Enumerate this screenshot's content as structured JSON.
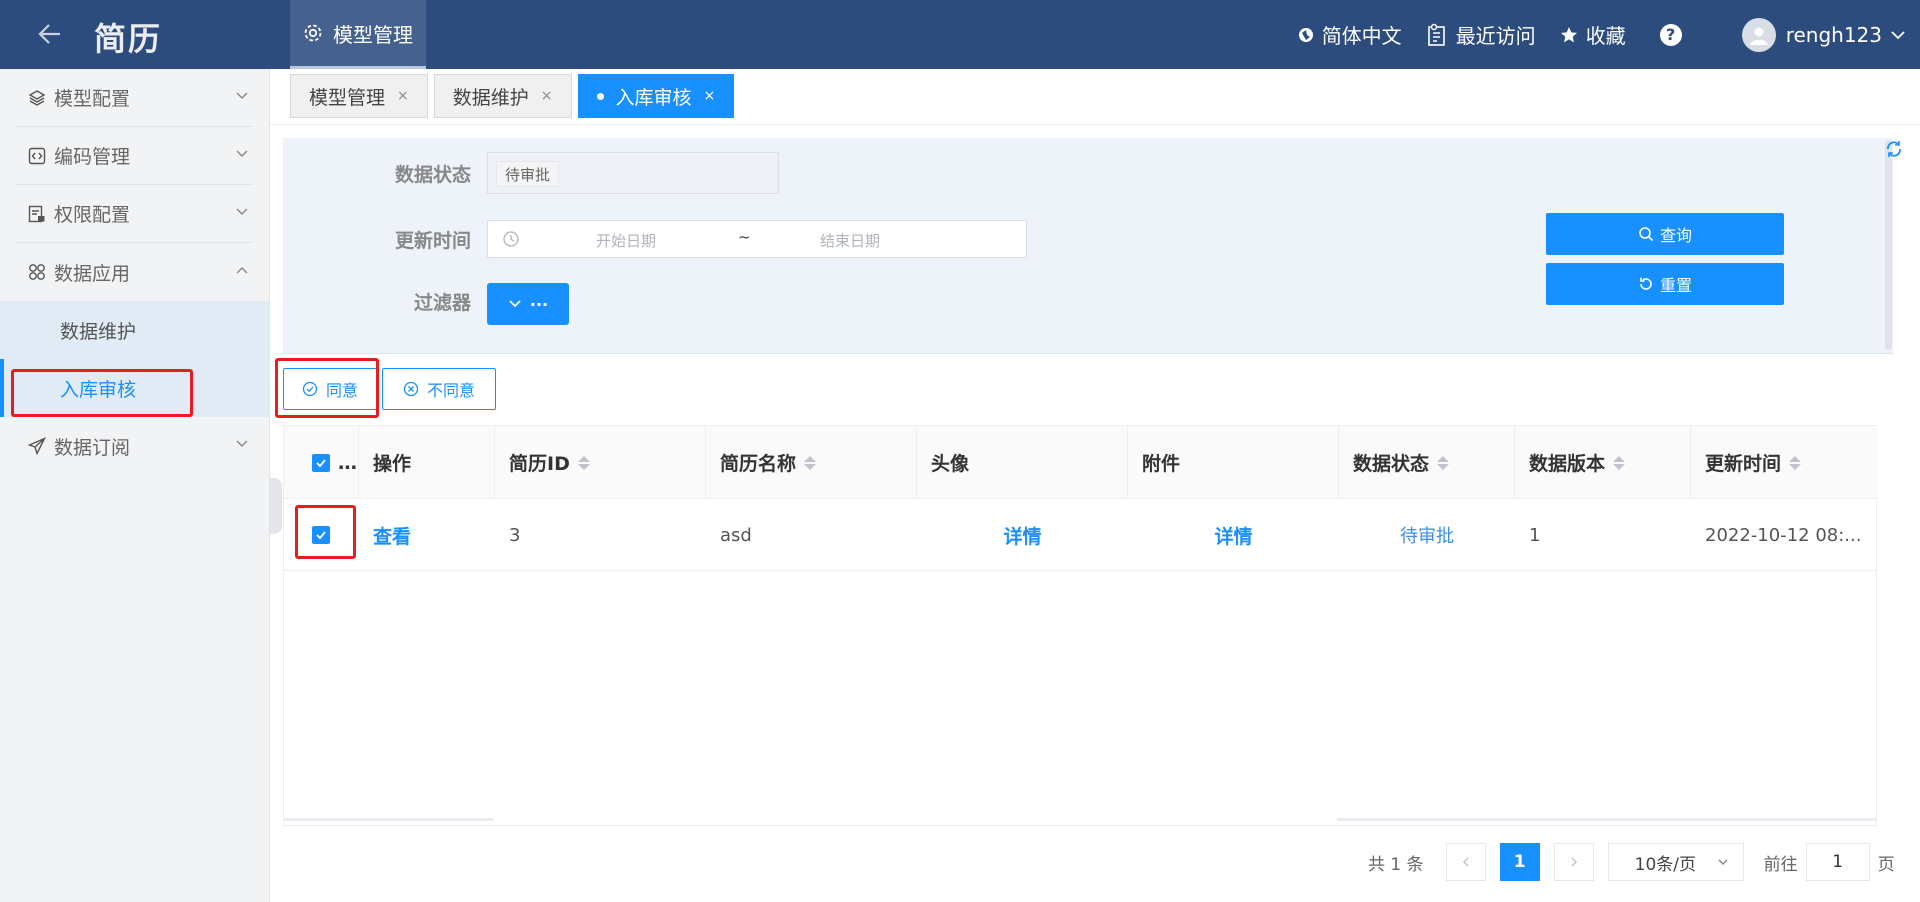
{
  "header": {
    "app_title": "简历",
    "active_module": "模型管理",
    "language": "简体中文",
    "recent": "最近访问",
    "favorites": "收藏",
    "help": "?",
    "username": "rengh123"
  },
  "sidebar": {
    "items": [
      {
        "label": "模型配置"
      },
      {
        "label": "编码管理"
      },
      {
        "label": "权限配置"
      },
      {
        "label": "数据应用"
      },
      {
        "label": "数据订阅"
      }
    ],
    "subitems": [
      {
        "label": "数据维护"
      },
      {
        "label": "入库审核"
      }
    ]
  },
  "tabs": [
    {
      "label": "模型管理"
    },
    {
      "label": "数据维护"
    },
    {
      "label": "入库审核"
    }
  ],
  "filter": {
    "status_label": "数据状态",
    "status_value": "待审批",
    "time_label": "更新时间",
    "start_placeholder": "开始日期",
    "range_sep": "~",
    "end_placeholder": "结束日期",
    "filter_label": "过滤器",
    "filter_more": "···",
    "query_btn": "查询",
    "reset_btn": "重置"
  },
  "actions": {
    "approve": "同意",
    "reject": "不同意"
  },
  "table": {
    "columns": {
      "check": "…",
      "op": "操作",
      "id": "简历ID",
      "name": "简历名称",
      "avatar": "头像",
      "attachment": "附件",
      "status": "数据状态",
      "version": "数据版本",
      "updated": "更新时间"
    },
    "rows": [
      {
        "op": "查看",
        "id": "3",
        "name": "asd",
        "avatar": "详情",
        "attachment": "详情",
        "status": "待审批",
        "version": "1",
        "updated": "2022-10-12 08:..."
      }
    ]
  },
  "pagination": {
    "total": "共 1 条",
    "current_page": "1",
    "page_size": "10条/页",
    "goto": "前往",
    "goto_value": "1",
    "page_unit": "页"
  },
  "colors": {
    "header_bg": "#2c4c7e",
    "primary": "#1890ff",
    "highlight": "#e51d1d"
  }
}
